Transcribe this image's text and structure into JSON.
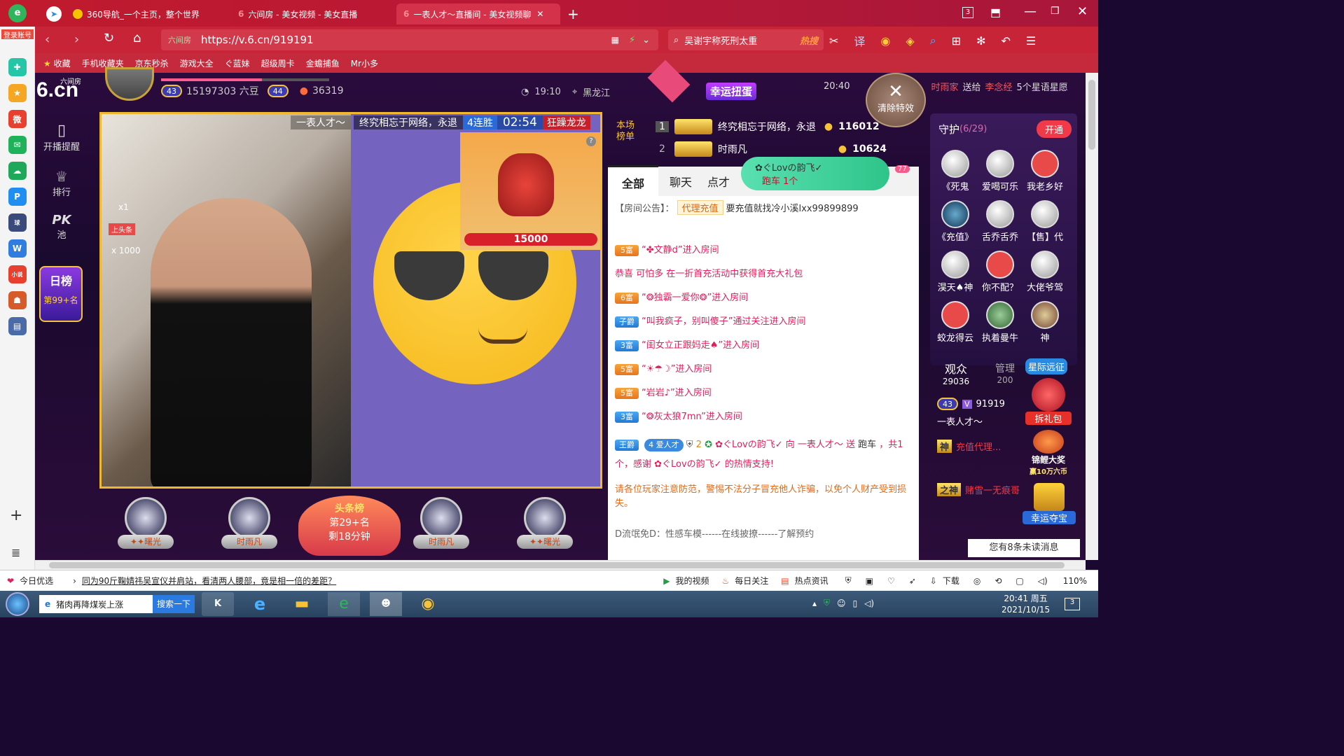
{
  "browser": {
    "login_label": "登录账号",
    "tabs": [
      "360导航_一个主页，整个世界",
      "六间房 - 美女视频 - 美女直播",
      "一表人才～直播间 - 美女视频聊"
    ],
    "tab_count": "3",
    "url_site": "六间房",
    "url": "https://v.6.cn/919191",
    "search_text": "吴谢宇称死刑太重",
    "search_hot": "热搜",
    "bookmarks": [
      "收藏",
      "手机收藏夹",
      "京东秒杀",
      "游戏大全",
      "ぐ蓝妹",
      "超级周卡",
      "金蟾捕鱼",
      "Mr小多"
    ],
    "icons": [
      "back-icon",
      "forward-icon",
      "refresh-icon",
      "home-icon",
      "search-icon",
      "gear-icon"
    ]
  },
  "leftbar": {
    "items": [
      "浏览器安全",
      "收藏",
      "微博",
      "邮箱",
      "云盘",
      "P",
      "顶球网",
      "文档",
      "小说",
      "游戏",
      "更多"
    ]
  },
  "site": {
    "logo": "6.cn",
    "logo_sub": "六间房",
    "sidebar": [
      {
        "label": "开播提醒"
      },
      {
        "label": "排行"
      },
      {
        "label": "PK池",
        "text": "PK"
      }
    ],
    "rank_badge": {
      "title": "日榜",
      "rank": "第99+名"
    },
    "host": {
      "level1": "43",
      "beans": "15197303 六豆",
      "level2": "44",
      "fans": "36319",
      "time": "19:10",
      "location": "黑龙江"
    },
    "banner": {
      "lucky_egg": "幸运扭蛋",
      "gift_time": "20:40",
      "gift_msg_user": "时雨家",
      "gift_msg_mid": "送给",
      "gift_to": "李念经",
      "gift_item": "5个星语星愿"
    },
    "clear_effects": "清除特效",
    "video": {
      "room_name": "一表人才～",
      "pk_user": "终究相忘于网络，永退",
      "streak": "4连胜",
      "timer": "02:54",
      "dragon_name": "狂躁龙龙",
      "dragon_value": "15000",
      "side_x1": "x1",
      "side_x1000": "x 1000",
      "side_tag": "上头条"
    },
    "seats": [
      {
        "label": "✦✦曙光"
      },
      {
        "label": "时雨凡"
      },
      {
        "label": "时雨凡"
      },
      {
        "label": "✦✦曙光"
      }
    ],
    "headline": {
      "title": "头条榜",
      "rank": "第29+名",
      "remain": "剩18分钟"
    },
    "leaderboard": {
      "title": "本场榜单",
      "rows": [
        {
          "rank": "1",
          "name": "终究相忘于网络，永退",
          "value": "116012"
        },
        {
          "rank": "2",
          "name": "时雨凡",
          "value": "10624"
        }
      ]
    },
    "chat_tabs": [
      "全部",
      "聊天",
      "点才"
    ],
    "car_notice": {
      "user": "✿ぐLovの韵飞✓",
      "msg": "跑车 1个",
      "count": "77"
    },
    "announcement": {
      "label": "【房间公告】：",
      "tag": "代理充值",
      "text": "要充值就找冷小溪lxx99899899"
    },
    "chat": [
      {
        "rank": "5富",
        "text": "“✤文静d”进入房间"
      },
      {
        "rank": "",
        "text": "恭喜 可怕多 在一折首充活动中获得首充大礼包"
      },
      {
        "rank": "6富",
        "text": "“❂独霸一爱你❂”进入房间"
      },
      {
        "rank": "子爵",
        "text": "“叫我疯子，别叫傻子”通过关注进入房间"
      },
      {
        "rank": "3富",
        "text": "“闺女立正跟妈走♠”进入房间"
      },
      {
        "rank": "5富",
        "text": "“☀☂☽”进入房间"
      },
      {
        "rank": "5富",
        "text": "“岩岩♪”进入房间"
      },
      {
        "rank": "3富",
        "text": "“❂灰太狼7mn”进入房间"
      }
    ],
    "gift_line": {
      "badge": "王爵",
      "level": "4 爱人才",
      "level_num": "2",
      "text": "✿ぐLovの韵飞✓ 向 一表人才～ 送",
      "gift": "跑车",
      "tail": "，共1个，感谢 ✿ぐLovの韵飞✓ 的热情支持!"
    },
    "warning": "请各位玩家注意防范，警惕不法分子冒充他人诈骗，以免个人财产受到损失。",
    "promo": "D流氓免D：性感车模------在线披撩------了解预约",
    "guards": {
      "title": "守护",
      "count": "(6/29)",
      "open_btn": "开通",
      "list": [
        "《死鬼",
        "爱喝可乐",
        "我老乡好",
        "《充值》",
        "舌乔舌乔",
        "【售】代",
        "淏天♠神",
        "你不配？",
        "大佬爷驾",
        "蛟龙得云",
        "执着曼牛",
        "神"
      ]
    },
    "audience": {
      "label": "观众",
      "count": "29036",
      "mgr_label": "管理",
      "mgr_count": "200",
      "expedition": "星际远征"
    },
    "members": [
      {
        "level": "43",
        "id": "91919",
        "name": "一表人才～"
      },
      {
        "badge": "神",
        "text": "充值代理..."
      },
      {
        "badge": "之神",
        "text": "赌雪一无痕哥"
      }
    ],
    "gifts": {
      "red_packet": "拆礼包",
      "carp": "锦鲤大奖",
      "carp_sub": "赢10万六币",
      "treasure": "幸运夺宝"
    },
    "unread": "您有8条未读消息"
  },
  "statusbar": {
    "left": "今日优选",
    "news": "同为90斤鞠婧祎吴宣仪并肩站，看清两人腰部，竟是相一倍的差距？",
    "items": [
      "我的视频",
      "每日关注",
      "热点资讯",
      "下载"
    ],
    "zoom": "110%"
  },
  "taskbar": {
    "search_text": "猪肉再降煤炭上涨",
    "search_btn": "搜索一下",
    "time": "20:41 周五",
    "date": "2021/10/15",
    "notif": "3"
  },
  "colors": {
    "brand": "#c41a30",
    "chat_pink": "#e0205a",
    "gold": "#f5b52a",
    "accent_green": "#2ec48a"
  }
}
